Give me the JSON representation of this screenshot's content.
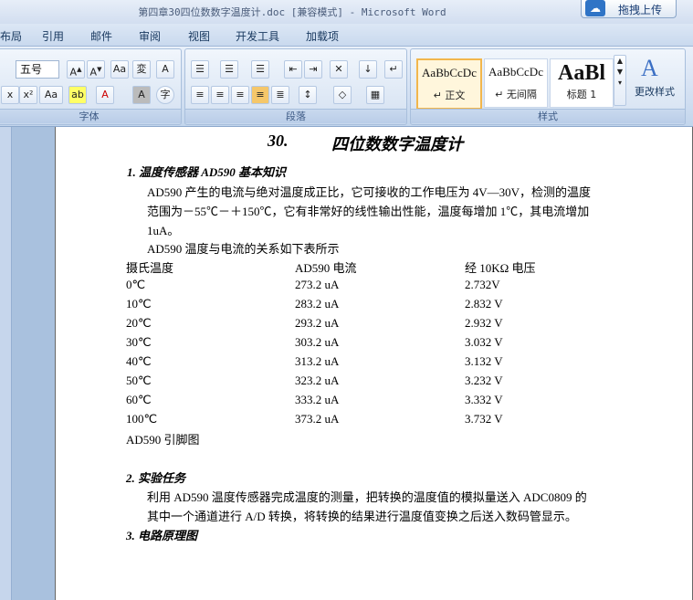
{
  "window": {
    "title": "第四章30四位数数字温度计.doc [兼容模式] - Microsoft Word",
    "upload_label": "拖拽上传"
  },
  "tabs": [
    "布局",
    "引用",
    "邮件",
    "审阅",
    "视图",
    "开发工具",
    "加载项"
  ],
  "ribbon": {
    "font_group": {
      "label": "字体",
      "font_size": "五号"
    },
    "paragraph_group": {
      "label": "段落"
    },
    "styles_group": {
      "label": "样式",
      "styles": [
        {
          "sample": "AaBbCcDc",
          "name": "↵ 正文"
        },
        {
          "sample": "AaBbCcDc",
          "name": "↵ 无间隔"
        },
        {
          "sample": "AaBl",
          "name": "标题 1"
        }
      ],
      "change_styles": "更改样式"
    }
  },
  "document": {
    "title_num": "30.",
    "title": "四位数数字温度计",
    "s1_heading": "1.  温度传感器 AD590 基本知识",
    "p1_l1": "AD590 产生的电流与绝对温度成正比，它可接收的工作电压为 4V—30V，检测的温度",
    "p1_l2": "范围为－55℃－＋150℃，它有非常好的线性输出性能，温度每增加 1℃，其电流增加",
    "p1_l3": "1uA。",
    "p2": "AD590 温度与电流的关系如下表所示",
    "table_headers": [
      "摄氏温度",
      "AD590 电流",
      "经 10KΩ 电压"
    ],
    "table_rows": [
      [
        "0℃",
        "273.2 uA",
        "2.732V"
      ],
      [
        "10℃",
        "283.2 uA",
        "2.832 V"
      ],
      [
        "20℃",
        "293.2 uA",
        "2.932 V"
      ],
      [
        "30℃",
        "303.2 uA",
        "3.032 V"
      ],
      [
        "40℃",
        "313.2 uA",
        "3.132 V"
      ],
      [
        "50℃",
        "323.2 uA",
        "3.232 V"
      ],
      [
        "60℃",
        "333.2 uA",
        "3.332 V"
      ],
      [
        "100℃",
        "373.2 uA",
        "3.732 V"
      ]
    ],
    "pinout": "AD590 引脚图",
    "s2_heading": "2.  实验任务",
    "p3_l1": "利用 AD590 温度传感器完成温度的测量，把转换的温度值的模拟量送入 ADC0809 的",
    "p3_l2": "其中一个通道进行 A/D 转换，将转换的结果进行温度值变换之后送入数码管显示。",
    "s3_heading": "3.  电路原理图"
  }
}
